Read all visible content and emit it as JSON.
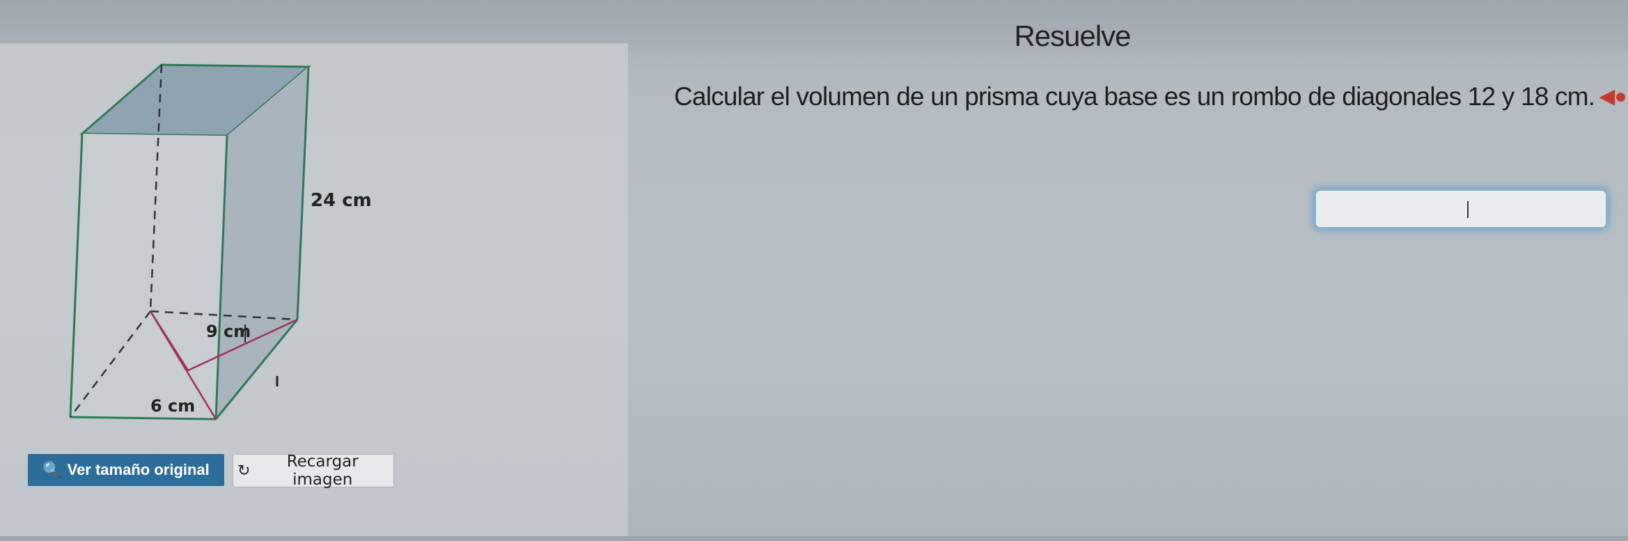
{
  "exercise": {
    "title": "Resuelve",
    "problem_text": "Calcular el volumen de un prisma cuya base es un rombo de diagonales 12 y 18 cm.",
    "speaker_icon": "speaker-icon"
  },
  "figure": {
    "labels": {
      "height": "24 cm",
      "half_diagonal_long": "9 cm",
      "half_diagonal_short": "6 cm"
    }
  },
  "answer": {
    "value": ""
  },
  "buttons": {
    "view_original": "Ver tamaño original",
    "view_original_icon": "magnifier-icon",
    "reload_image": "Recargar imagen",
    "reload_image_icon": "reload-icon"
  },
  "colors": {
    "button_primary": "#2d6d99",
    "prism_edges": "#2f7a55",
    "prism_top_face": "#8fa3b3",
    "diagonal_lines": "#a0305a"
  }
}
